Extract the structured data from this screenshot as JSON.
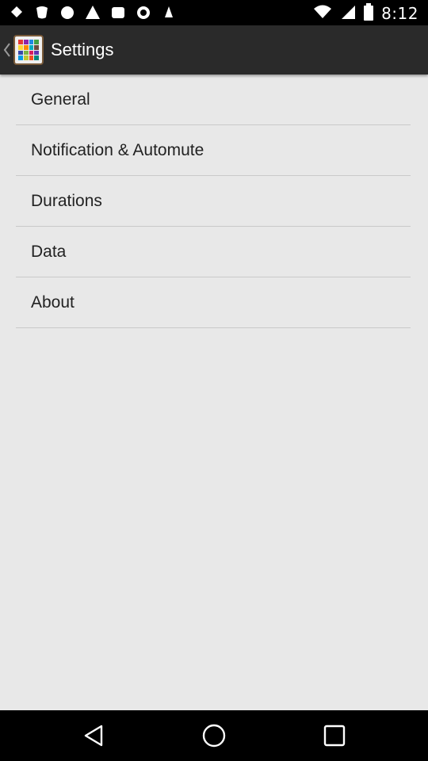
{
  "status_bar": {
    "time": "8:12",
    "left_icons": [
      "notification-icon",
      "notification-icon",
      "notification-icon",
      "notification-icon",
      "notification-icon",
      "notification-icon",
      "notification-icon"
    ],
    "right_icons": [
      "wifi-icon",
      "signal-icon",
      "battery-icon"
    ]
  },
  "action_bar": {
    "title": "Settings",
    "up_icon": "back-chevron-icon",
    "app_icon": "app-grid-icon"
  },
  "settings_list": [
    {
      "label": "General"
    },
    {
      "label": "Notification & Automute"
    },
    {
      "label": "Durations"
    },
    {
      "label": "Data"
    },
    {
      "label": "About"
    }
  ],
  "nav_bar": {
    "buttons": [
      "back-icon",
      "home-icon",
      "recents-icon"
    ]
  },
  "colors": {
    "action_bar": "#2a2a2a",
    "background": "#e8e8e8",
    "divider": "#c9c9c9"
  }
}
